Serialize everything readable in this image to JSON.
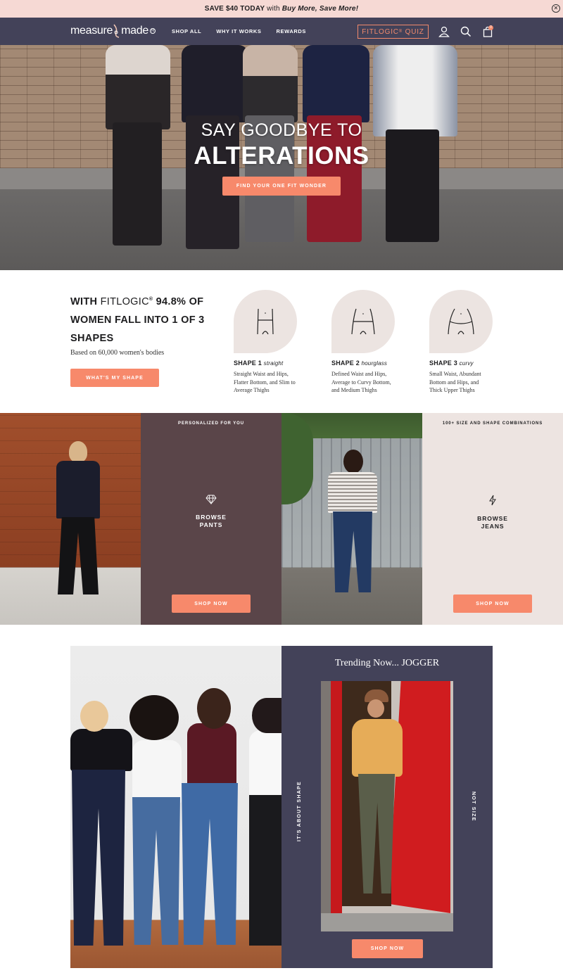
{
  "announcement": {
    "prefix": "SAVE $40 TODAY",
    "with": " with ",
    "emphasis": "Buy More, Save More!"
  },
  "header": {
    "logo_left": "measure",
    "logo_right": "made",
    "nav": [
      "SHOP ALL",
      "WHY IT WORKS",
      "REWARDS"
    ],
    "quiz_label": "FITLOGIC",
    "quiz_reg": "®",
    "quiz_suffix": " QUIZ",
    "cart_count": "0",
    "icons": [
      "user-icon",
      "search-icon",
      "cart-icon"
    ]
  },
  "hero": {
    "line1": "SAY GOODBYE TO",
    "line2": "ALTERATIONS",
    "cta": "FIND YOUR ONE FIT WONDER"
  },
  "shapes": {
    "title_with": "WITH ",
    "title_brand": "FITLOGIC",
    "title_reg": "®",
    "title_rest": " 94.8% OF WOMEN FALL INTO 1 OF 3 SHAPES",
    "subtitle": "Based on 60,000 women's bodies",
    "button": "WHAT'S MY SHAPE",
    "items": [
      {
        "name": "SHAPE 1",
        "type": "straight",
        "desc": "Straight Waist and Hips, Flatter Bottom, and Slim to Average Thighs"
      },
      {
        "name": "SHAPE 2",
        "type": "hourglass",
        "desc": "Defined Waist and Hips, Average to Curvy Bottom, and Medium Thighs"
      },
      {
        "name": "SHAPE 3",
        "type": "curvy",
        "desc": "Small Waist, Abundant Bottom and Hips, and Thick Upper Thighs"
      }
    ]
  },
  "browse": {
    "pants": {
      "top_label": "PERSONALIZED FOR YOU",
      "line1": "BROWSE",
      "line2": "PANTS",
      "button": "SHOP NOW"
    },
    "jeans": {
      "top_label": "100+ SIZE AND SHAPE COMBINATIONS",
      "line1": "BROWSE",
      "line2": "JEANS",
      "button": "SHOP NOW"
    }
  },
  "trending": {
    "title": "Trending Now... JOGGER",
    "left_vertical": "IT'S ABOUT SHAPE",
    "right_vertical": "NOT SIZE",
    "button": "SHOP NOW"
  },
  "colors": {
    "accent": "#f7896b",
    "header_bg": "#434259",
    "announcement_bg": "#f6d9d4",
    "tile_dark": "#5a4549",
    "tile_light": "#ede4e1"
  }
}
